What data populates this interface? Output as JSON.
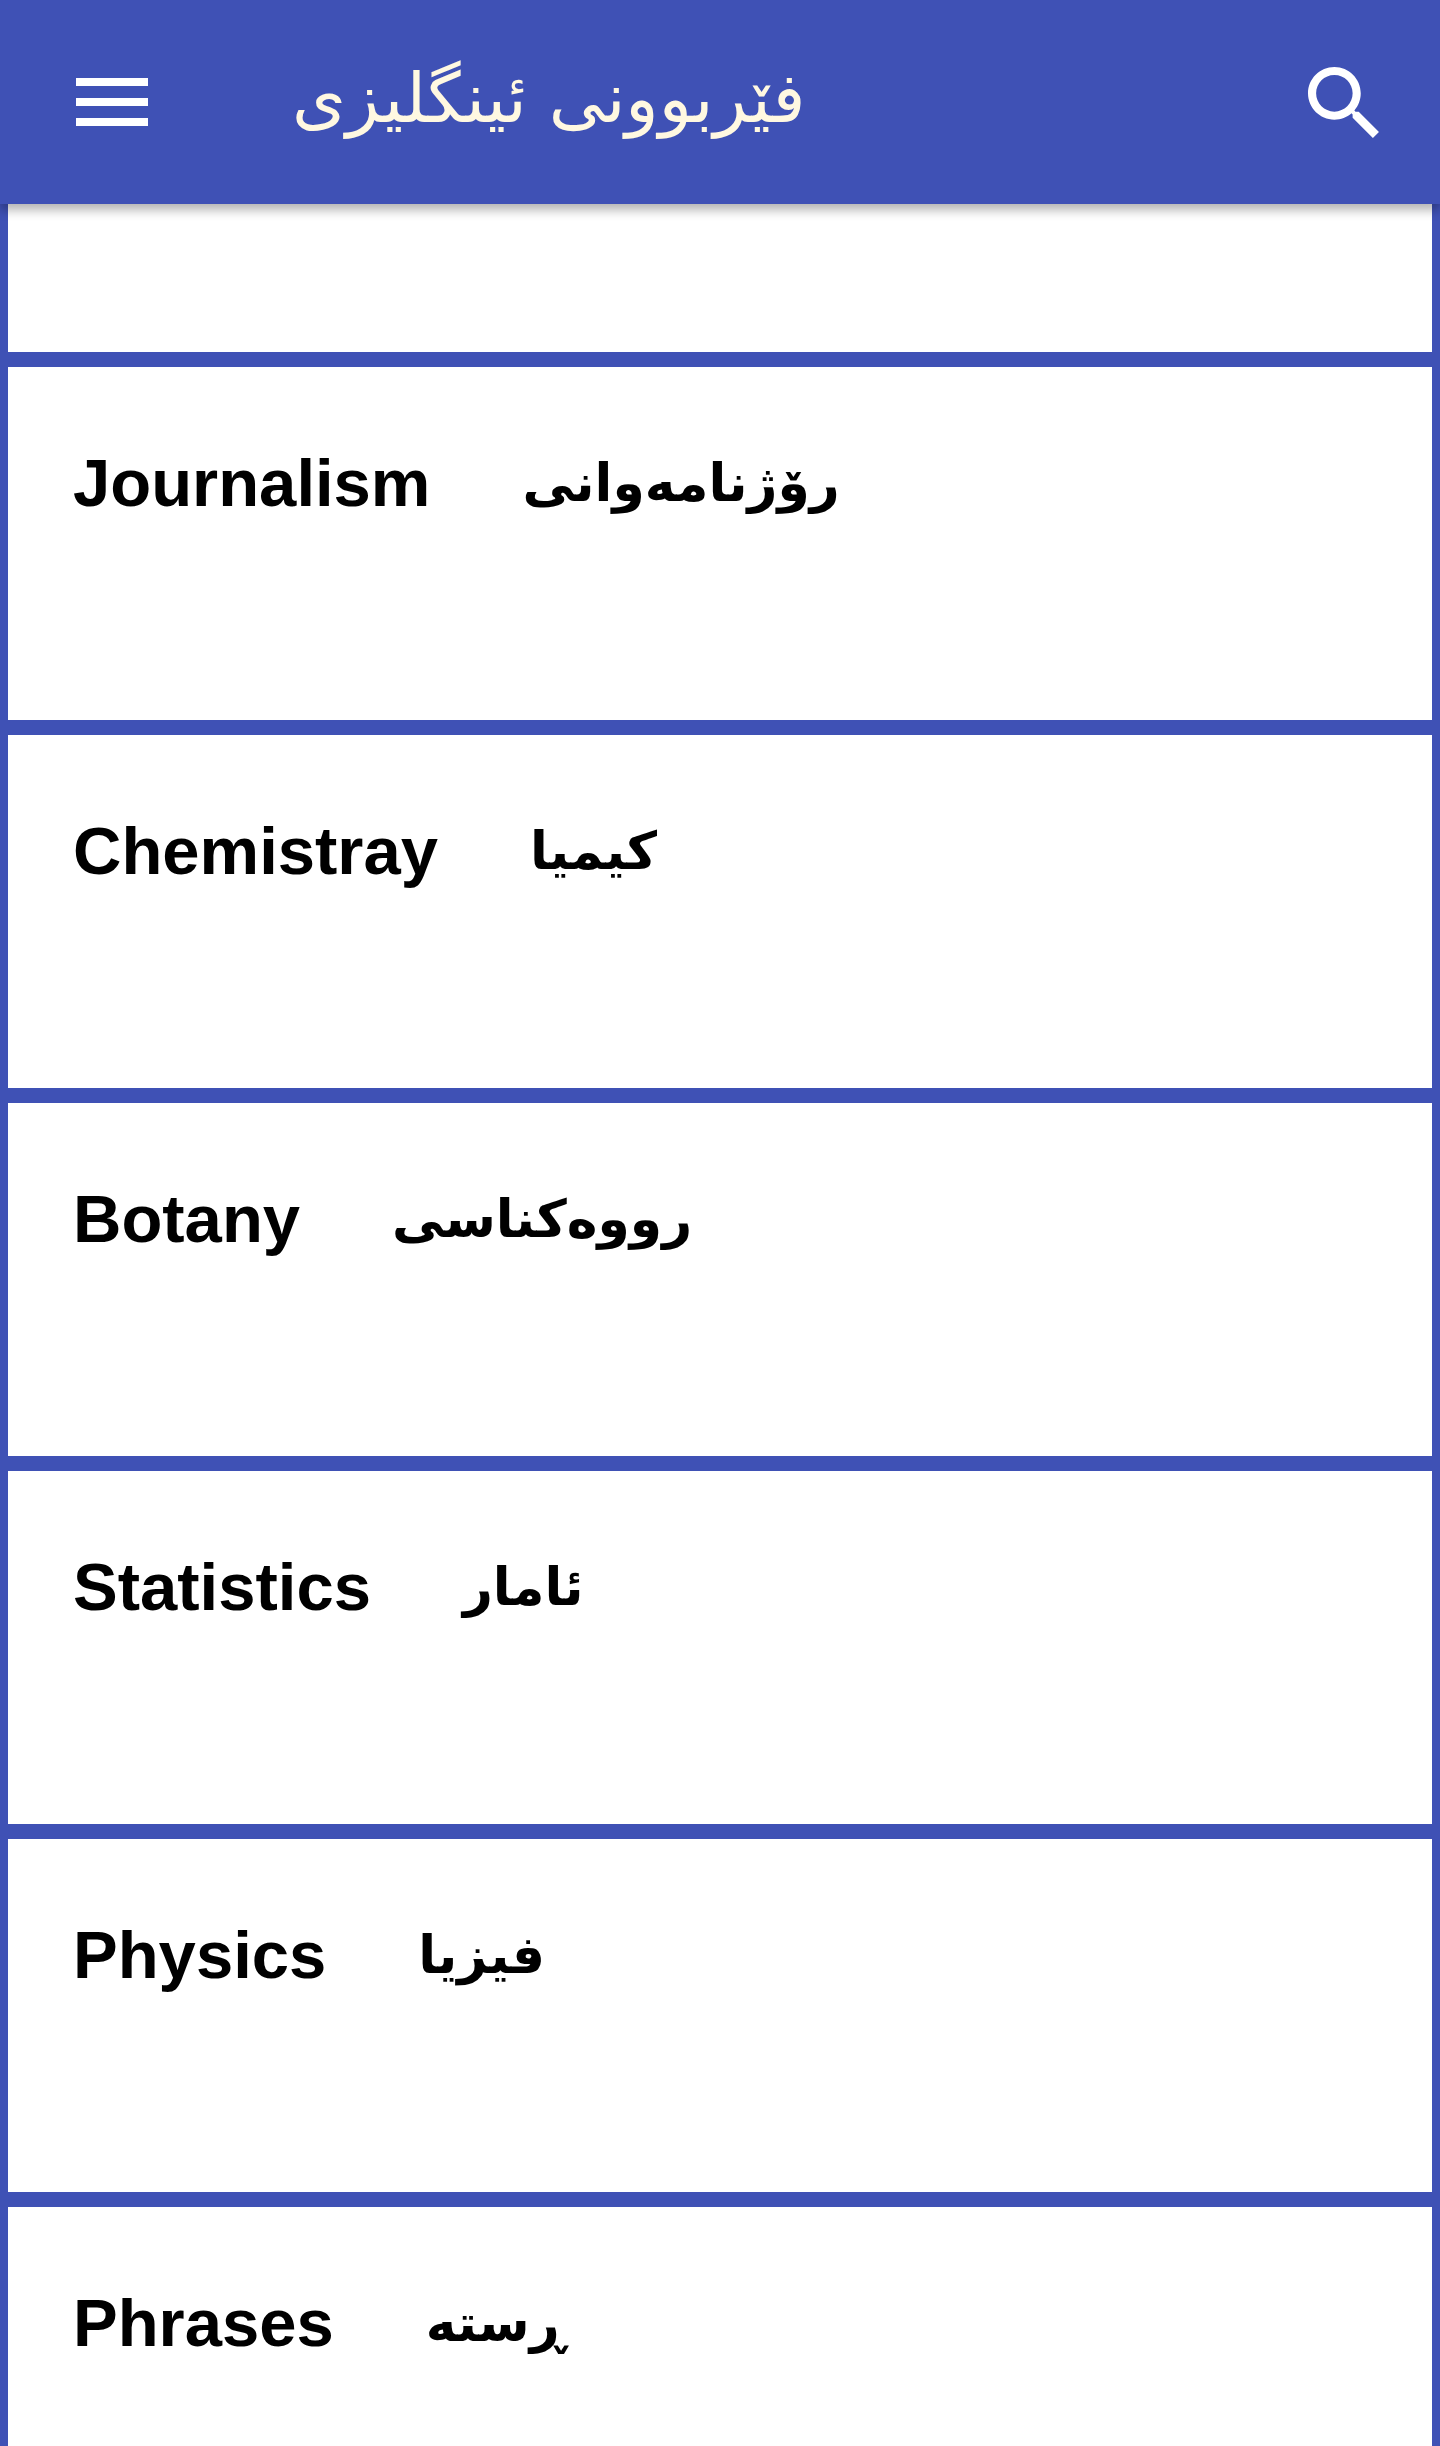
{
  "app_bar": {
    "title": "فێربوونی ئینگلیزی"
  },
  "subjects": [
    {
      "english": "Journalism",
      "kurdish": "رۆژنامەوانی"
    },
    {
      "english": "Chemistray",
      "kurdish": "کیمیا"
    },
    {
      "english": "Botany",
      "kurdish": "رووەکناسی"
    },
    {
      "english": "Statistics",
      "kurdish": "ئامار"
    },
    {
      "english": "Physics",
      "kurdish": "فیزیا"
    },
    {
      "english": "Phrases",
      "kurdish": "ڕستە"
    }
  ]
}
